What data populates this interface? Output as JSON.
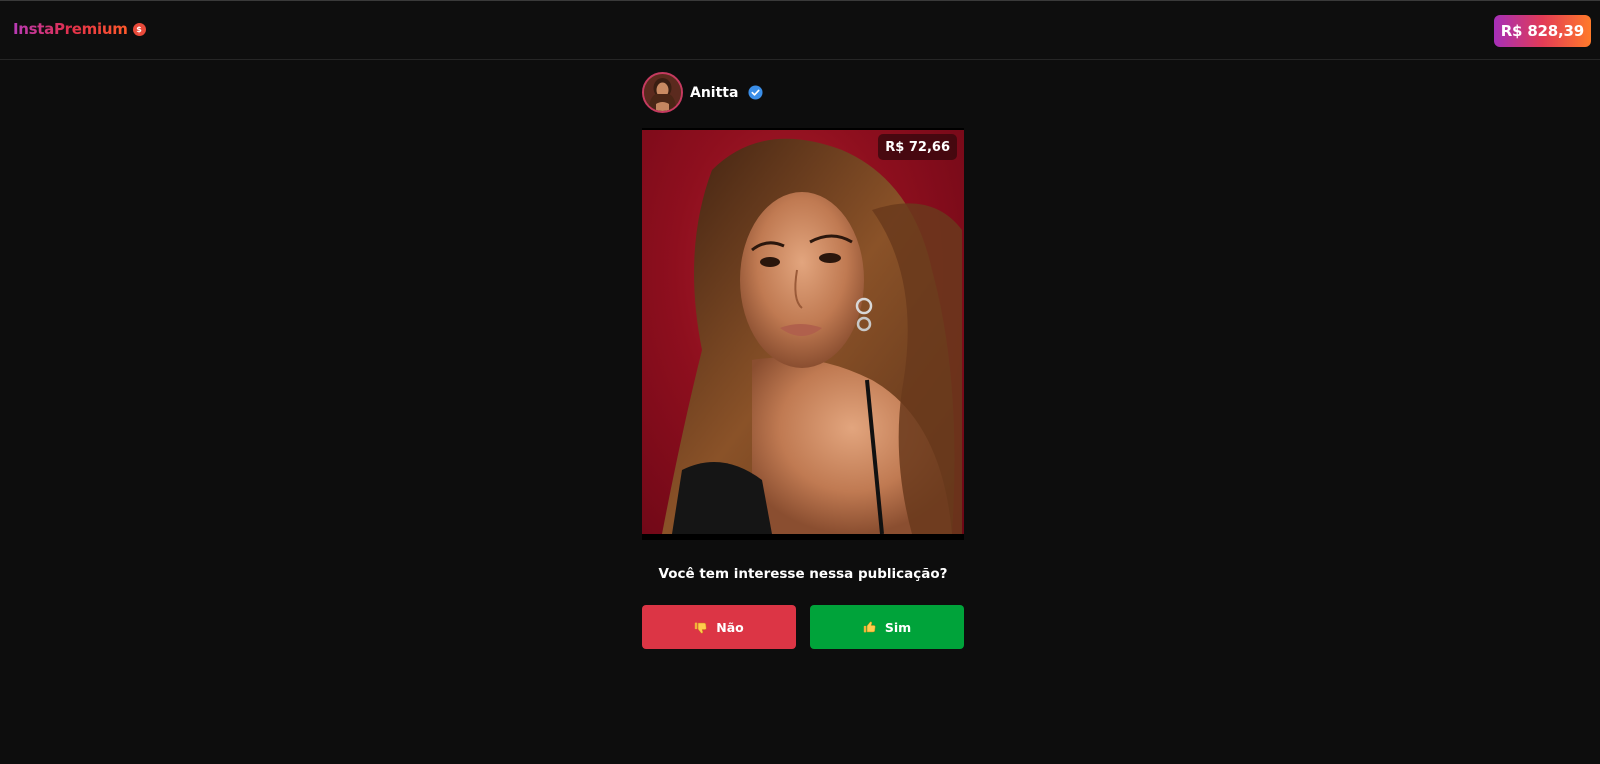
{
  "header": {
    "brand": "InstaPremium",
    "coin_symbol": "$",
    "balance": "R$ 828,39"
  },
  "post": {
    "username": "Anitta",
    "price": "R$ 72,66",
    "question": "Você tem interesse nessa publicação?",
    "buttons": {
      "no_label": "Não",
      "yes_label": "Sim"
    },
    "icons": {
      "verified": "verified-badge-icon",
      "no": "thumbs-down-icon",
      "yes": "thumbs-up-icon"
    }
  },
  "colors": {
    "background": "#0d0d0d",
    "no_button": "#dc3545",
    "yes_button": "#00a33a",
    "verified": "#3a8ee8"
  }
}
